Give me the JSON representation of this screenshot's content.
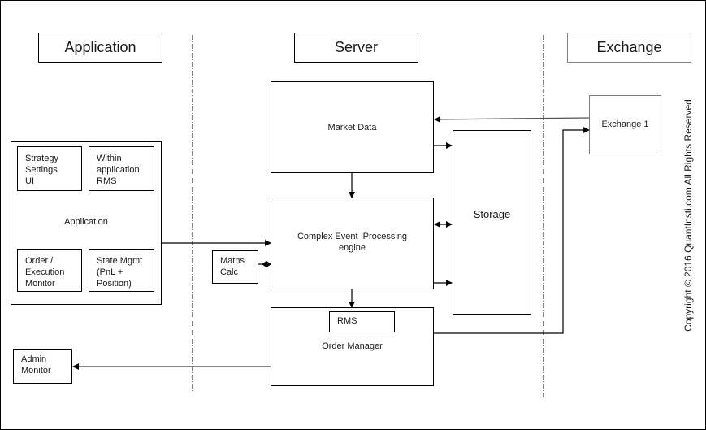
{
  "lanes": {
    "application": "Application",
    "server": "Server",
    "exchange": "Exchange"
  },
  "application_block": {
    "label": "Application",
    "modules": [
      "Strategy\nSettings\nUI",
      "Within\napplication\nRMS",
      "Order /\nExecution\nMonitor",
      "State Mgmt\n(PnL +\nPosition)"
    ]
  },
  "server": {
    "market_data": "Market Data",
    "cep_engine_line1": "Complex Event  Processing",
    "cep_engine_line2": "engine",
    "maths_calc": "Maths\nCalc",
    "order_manager": "Order Manager",
    "rms": "RMS",
    "storage": "Storage"
  },
  "exchange": {
    "exchange_1": "Exchange 1"
  },
  "admin_monitor": "Admin\nMonitor",
  "copyright": "Copyright © 2016 QuantInsti.com All Rights Reserved",
  "colors": {
    "line": "#000000",
    "exchange_border": "#7f7f7f",
    "feed_line": "#555555"
  }
}
